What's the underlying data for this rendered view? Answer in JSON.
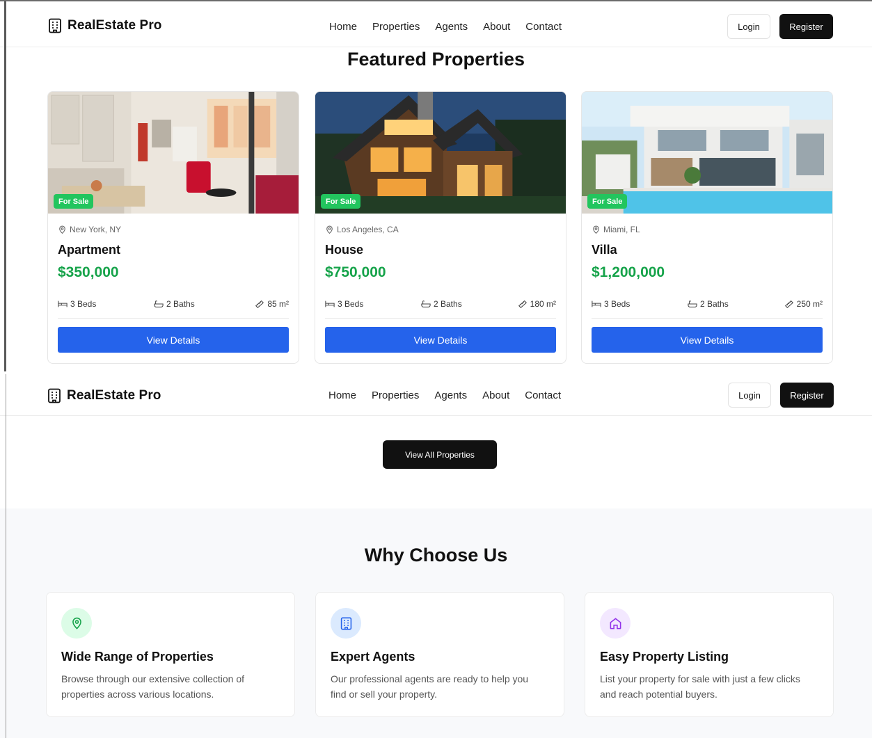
{
  "header": {
    "brand": "RealEstate Pro",
    "nav": [
      "Home",
      "Properties",
      "Agents",
      "About",
      "Contact"
    ],
    "login": "Login",
    "register": "Register"
  },
  "featured": {
    "title": "Featured Properties",
    "cards": [
      {
        "badge": "For Sale",
        "location": "New York, NY",
        "type": "Apartment",
        "price": "$350,000",
        "beds": "3 Beds",
        "baths": "2 Baths",
        "area": "85 m²",
        "button": "View Details",
        "image": "apartment-interior"
      },
      {
        "badge": "For Sale",
        "location": "Los Angeles, CA",
        "type": "House",
        "price": "$750,000",
        "beds": "3 Beds",
        "baths": "2 Baths",
        "area": "180 m²",
        "button": "View Details",
        "image": "house-exterior-night"
      },
      {
        "badge": "For Sale",
        "location": "Miami, FL",
        "type": "Villa",
        "price": "$1,200,000",
        "beds": "3 Beds",
        "baths": "2 Baths",
        "area": "250 m²",
        "button": "View Details",
        "image": "modern-villa-pool"
      }
    ]
  },
  "view_all": "View All Properties",
  "why": {
    "title": "Why Choose Us",
    "cards": [
      {
        "icon": "map-pin-icon",
        "title": "Wide Range of Properties",
        "desc": "Browse through our extensive collection of properties across various locations."
      },
      {
        "icon": "building-icon",
        "title": "Expert Agents",
        "desc": "Our professional agents are ready to help you find or sell your property."
      },
      {
        "icon": "home-icon",
        "title": "Easy Property Listing",
        "desc": "List your property for sale with just a few clicks and reach potential buyers."
      }
    ]
  },
  "colors": {
    "accent_blue": "#2563eb",
    "price_green": "#16a34a",
    "badge_green": "#22c55e",
    "dark": "#111111",
    "icon_green_bg": "#dcfce7",
    "icon_blue_bg": "#dbeafe",
    "icon_purple_bg": "#f3e8ff"
  }
}
